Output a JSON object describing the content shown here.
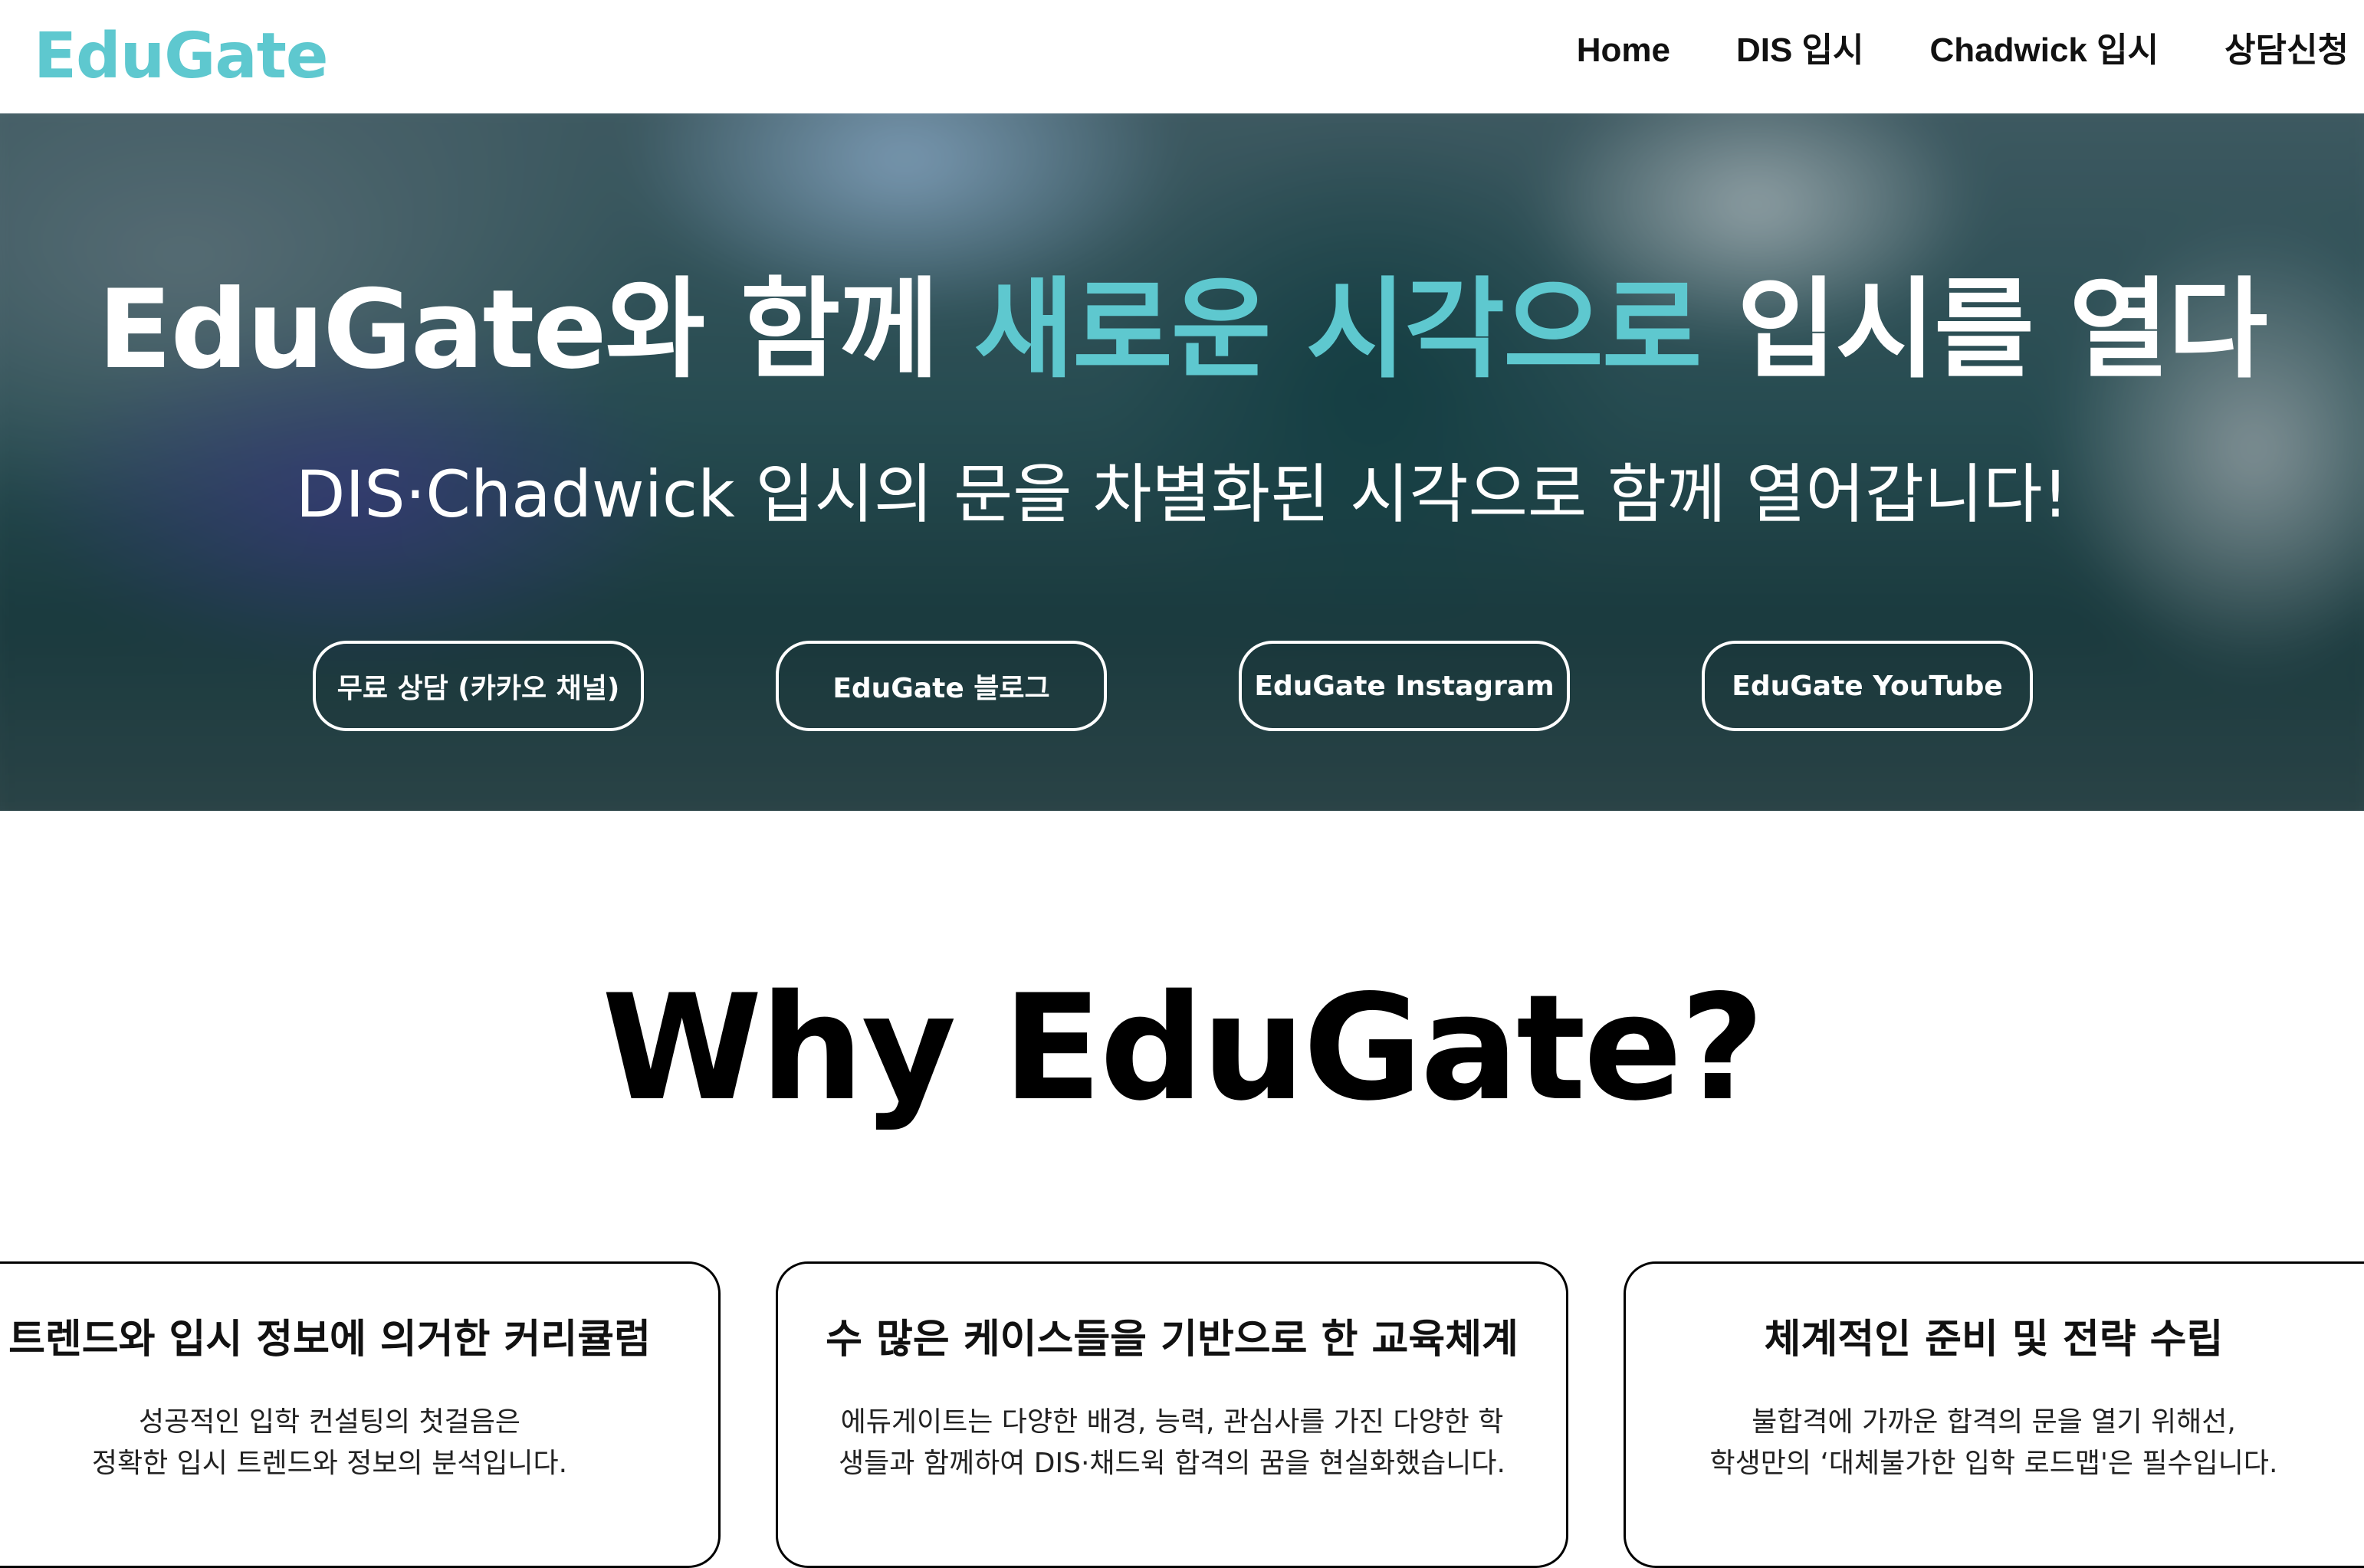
{
  "colors": {
    "accent": "#5ec8cf",
    "text_dark": "#111111",
    "hero_text": "#ffffff",
    "card_border": "#000000"
  },
  "header": {
    "logo": "EduGate",
    "nav": [
      {
        "label": "Home"
      },
      {
        "label": "DIS 입시"
      },
      {
        "label": "Chadwick 입시"
      },
      {
        "label": "상담신청"
      }
    ]
  },
  "hero": {
    "title_part1": "EduGate와 함께 ",
    "title_highlight": "새로운 시각으로",
    "title_part2": " 입시를 열다",
    "subtitle": "DIS·Chadwick 입시의 문을 차별화된 시각으로 함께 열어갑니다!",
    "buttons": [
      {
        "label": "무료 상담 (카카오 채널)"
      },
      {
        "label": "EduGate 블로그"
      },
      {
        "label": "EduGate Instagram"
      },
      {
        "label": "EduGate YouTube"
      }
    ]
  },
  "why": {
    "title": "Why EduGate?",
    "cards": [
      {
        "title": "트렌드와 입시 정보에 의거한 커리큘럼",
        "line1": "성공적인 입학 컨설팅의 첫걸음은",
        "line2": "정확한 입시 트렌드와 정보의 분석입니다."
      },
      {
        "title": "수 많은 케이스들을 기반으로 한 교육체계",
        "line1": "에듀게이트는 다양한 배경, 능력, 관심사를 가진 다양한 학",
        "line2": "생들과 함께하여 DIS·채드윅 합격의 꿈을 현실화했습니다."
      },
      {
        "title": "체계적인 준비 및 전략 수립",
        "line1": "불합격에 가까운 합격의 문을 열기 위해선,",
        "line2": "학생만의 ‘대체불가한 입학 로드맵'은 필수입니다."
      }
    ]
  }
}
